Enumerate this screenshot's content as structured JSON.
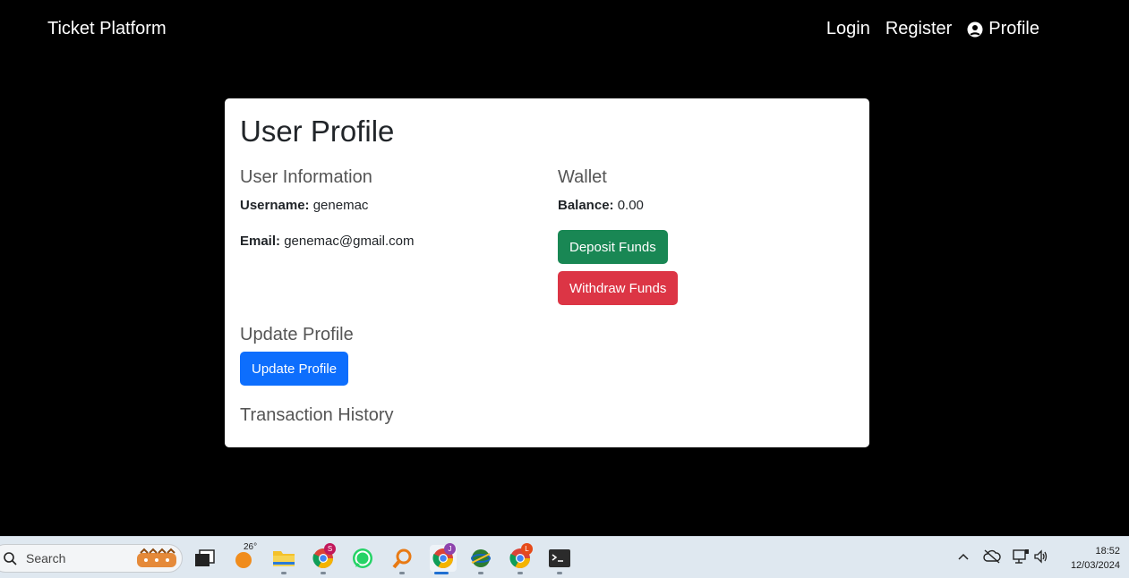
{
  "navbar": {
    "brand": "Ticket Platform",
    "login": "Login",
    "register": "Register",
    "profile": "Profile"
  },
  "profile": {
    "title": "User Profile",
    "user_info_heading": "User Information",
    "username_label": "Username:",
    "username": "genemac",
    "email_label": "Email:",
    "email": "genemac@gmail.com",
    "wallet_heading": "Wallet",
    "balance_label": "Balance:",
    "balance": "0.00",
    "deposit_button": "Deposit Funds",
    "withdraw_button": "Withdraw Funds",
    "update_heading": "Update Profile",
    "update_button": "Update Profile",
    "history_heading": "Transaction History"
  },
  "taskbar": {
    "search_placeholder": "Search",
    "weather_temp": "26°",
    "badges": {
      "chrome1": "S",
      "chrome2": "J",
      "chrome3": "L"
    },
    "time": "18:52",
    "date": "12/03/2024"
  },
  "colors": {
    "deposit": "#198754",
    "withdraw": "#dc3545",
    "update": "#0d6efd"
  }
}
